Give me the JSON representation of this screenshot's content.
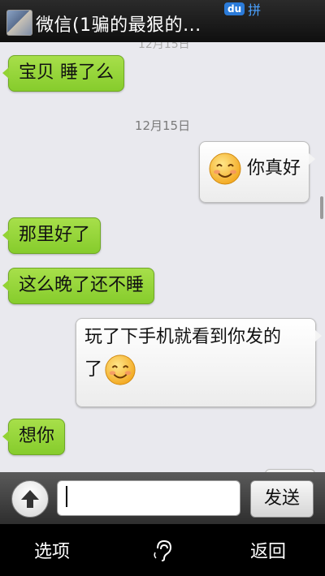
{
  "header": {
    "title": "微信(1骗的最狠的...",
    "ime": {
      "du": "du",
      "pin": "拼"
    }
  },
  "chat": {
    "faded_date": "12月15日",
    "date_separator": "12月15日",
    "messages": [
      {
        "side": "in",
        "text": "宝贝 睡了么"
      },
      {
        "side": "out",
        "text": "你真好",
        "icon": "smiley-icon"
      },
      {
        "side": "in",
        "text": "那里好了"
      },
      {
        "side": "in",
        "text": "这么晚了还不睡"
      },
      {
        "side": "out",
        "line1": "玩了下手机就看到你发的",
        "line2": "了",
        "icon": "smiley-icon"
      },
      {
        "side": "in",
        "text": "想你"
      }
    ]
  },
  "input": {
    "value": "",
    "send_label": "发送",
    "toggle_icon": "arrow-up-icon"
  },
  "menubar": {
    "options_label": "选项",
    "middle_icon": "voice-icon",
    "back_label": "返回"
  },
  "colors": {
    "incoming_bubble": "#93d335",
    "outgoing_bubble": "#f4f4f4",
    "topbar": "#1a1a1a",
    "chat_bg": "#e9e9ee"
  }
}
